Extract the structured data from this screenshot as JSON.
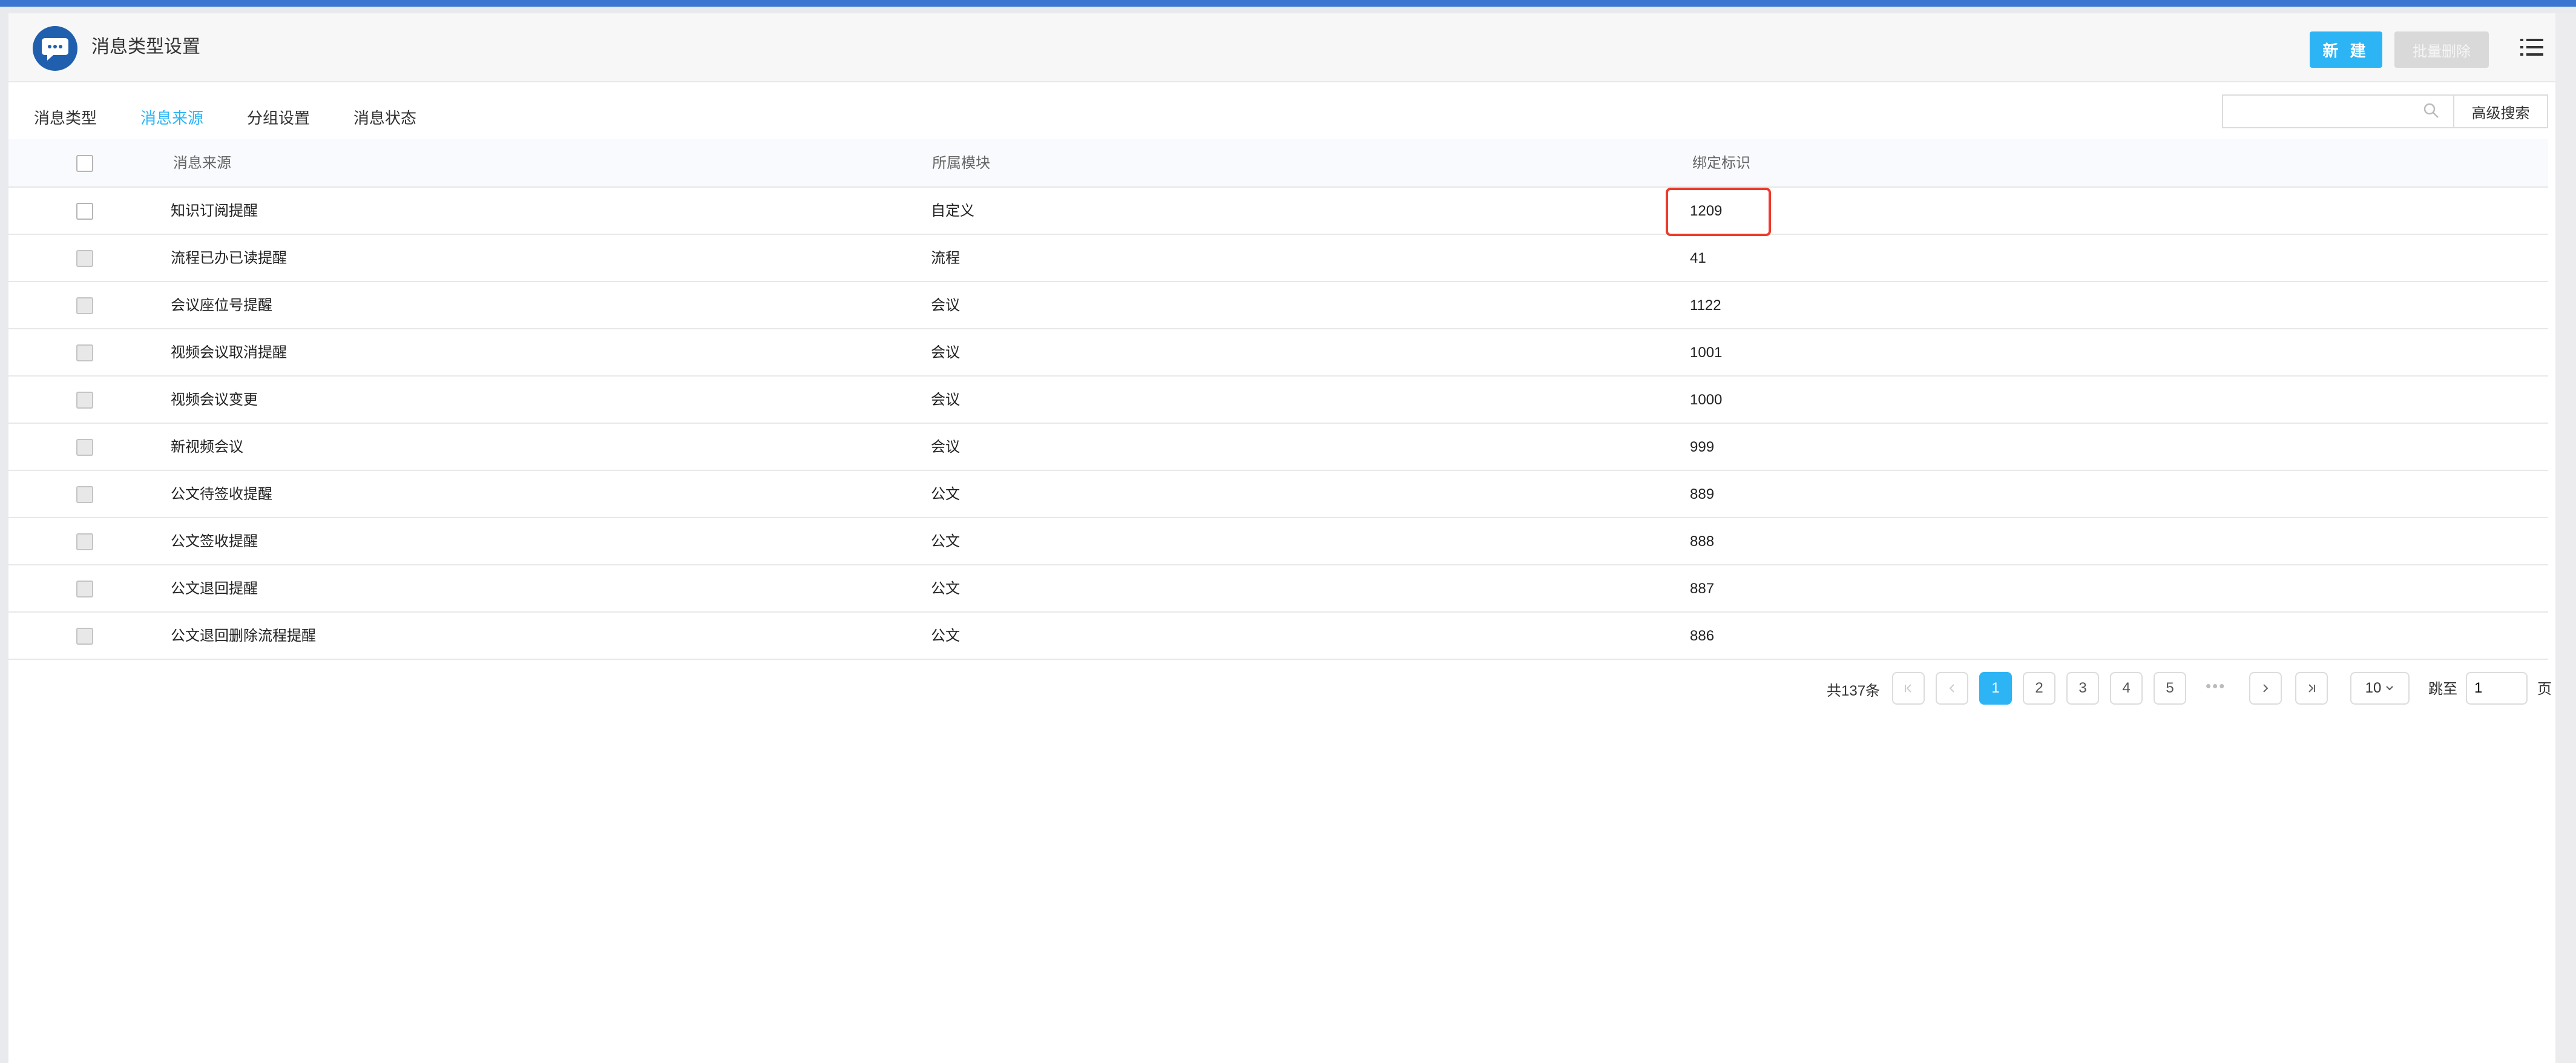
{
  "header": {
    "title": "消息类型设置",
    "new_button": "新 建",
    "batch_delete_button": "批量删除"
  },
  "tabs": [
    {
      "label": "消息类型",
      "active": false
    },
    {
      "label": "消息来源",
      "active": true
    },
    {
      "label": "分组设置",
      "active": false
    },
    {
      "label": "消息状态",
      "active": false
    }
  ],
  "search": {
    "value": "",
    "advanced_label": "高级搜索"
  },
  "table": {
    "columns": [
      "消息来源",
      "所属模块",
      "绑定标识"
    ],
    "rows": [
      {
        "source": "知识订阅提醒",
        "module": "自定义",
        "tag": "1209"
      },
      {
        "source": "流程已办已读提醒",
        "module": "流程",
        "tag": "41"
      },
      {
        "source": "会议座位号提醒",
        "module": "会议",
        "tag": "1122"
      },
      {
        "source": "视频会议取消提醒",
        "module": "会议",
        "tag": "1001"
      },
      {
        "source": "视频会议变更",
        "module": "会议",
        "tag": "1000"
      },
      {
        "source": "新视频会议",
        "module": "会议",
        "tag": "999"
      },
      {
        "source": "公文待签收提醒",
        "module": "公文",
        "tag": "889"
      },
      {
        "source": "公文签收提醒",
        "module": "公文",
        "tag": "888"
      },
      {
        "source": "公文退回提醒",
        "module": "公文",
        "tag": "887"
      },
      {
        "source": "公文退回删除流程提醒",
        "module": "公文",
        "tag": "886"
      }
    ]
  },
  "pagination": {
    "total_text": "共137条",
    "pages": [
      "1",
      "2",
      "3",
      "4",
      "5"
    ],
    "current_page": "1",
    "page_size": "10",
    "jump_label": "跳至",
    "jump_value": "1",
    "page_suffix": "页"
  },
  "colors": {
    "accent": "#2db4f5",
    "top_bar": "#3b77d0",
    "highlight_border": "#ee3a2a"
  }
}
